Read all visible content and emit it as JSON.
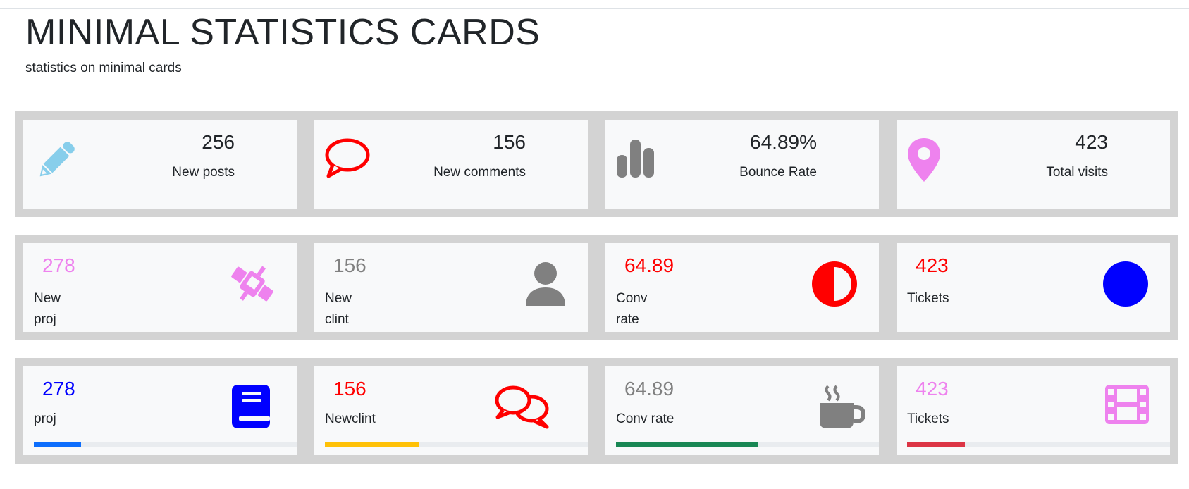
{
  "header": {
    "title": "MINIMAL STATISTICS CARDS",
    "subtitle": "statistics on minimal cards"
  },
  "row1": [
    {
      "value": "256",
      "label": "New posts",
      "icon": "pencil-icon",
      "color": "#87ceeb"
    },
    {
      "value": "156",
      "label": "New comments",
      "icon": "speech-bubble-icon",
      "color": "#ff0000"
    },
    {
      "value": "64.89%",
      "label": "Bounce Rate",
      "icon": "bar-chart-icon",
      "color": "#808080"
    },
    {
      "value": "423",
      "label": "Total visits",
      "icon": "map-marker-icon",
      "color": "#ee82ee"
    }
  ],
  "row2": [
    {
      "value": "278",
      "label": "New proj",
      "icon": "rocket-icon",
      "color": "#ee82ee"
    },
    {
      "value": "156",
      "label": "New clint",
      "icon": "user-icon",
      "color": "#808080"
    },
    {
      "value": "64.89",
      "label": "Conv rate",
      "icon": "half-circle-icon",
      "color": "#ff0000"
    },
    {
      "value": "423",
      "label": "Tickets",
      "icon": "circle-icon",
      "color": "#0000ff"
    }
  ],
  "row3": [
    {
      "value": "278",
      "label": "proj",
      "icon": "book-icon",
      "color": "#0000ff",
      "progress": 0.18,
      "bar_color": "#0d6efd"
    },
    {
      "value": "156",
      "label": "Newclint",
      "icon": "comments-icon",
      "color": "#ff0000",
      "progress": 0.36,
      "bar_color": "#ffc107"
    },
    {
      "value": "64.89",
      "label": "Conv rate",
      "icon": "coffee-icon",
      "color": "#808080",
      "progress": 0.54,
      "bar_color": "#198754"
    },
    {
      "value": "423",
      "label": "Tickets",
      "icon": "film-icon",
      "color": "#ee82ee",
      "progress": 0.22,
      "bar_color": "#dc3545"
    }
  ]
}
